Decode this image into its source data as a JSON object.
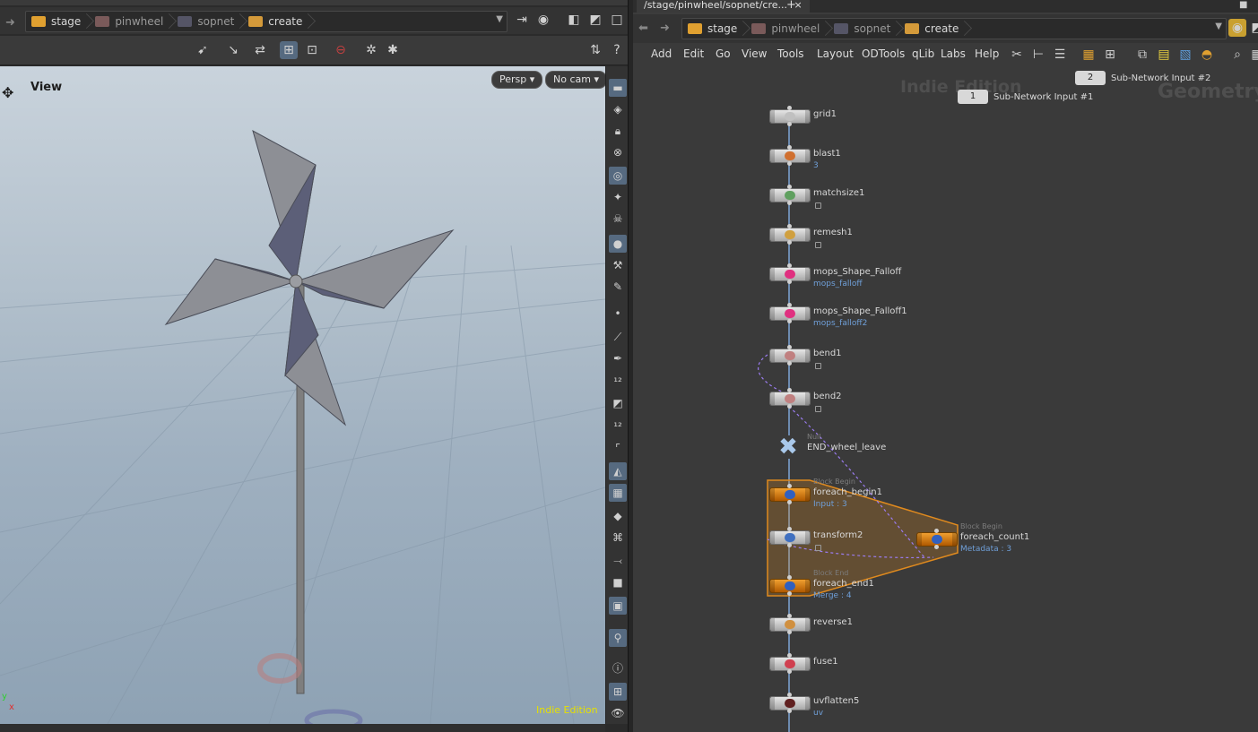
{
  "left_pane": {
    "path": [
      {
        "label": "stage"
      },
      {
        "label": "pinwheel"
      },
      {
        "label": "sopnet"
      },
      {
        "label": "create"
      }
    ],
    "viewport": {
      "title": "View",
      "persp_label": "Persp",
      "cam_label": "No cam",
      "indie_label": "Indie Edition",
      "axis_y": "y",
      "axis_x": "x"
    }
  },
  "right_pane": {
    "tab_label": "/stage/pinwheel/sopnet/cre...",
    "tab_close": "×",
    "tab_add": "+",
    "path": [
      {
        "label": "stage"
      },
      {
        "label": "pinwheel"
      },
      {
        "label": "sopnet"
      },
      {
        "label": "create"
      }
    ],
    "menu": [
      "Add",
      "Edit",
      "Go",
      "View",
      "Tools",
      "Layout",
      "ODTools",
      "qLib",
      "Labs",
      "Help"
    ],
    "watermark_indie": "Indie Edition",
    "watermark_geometry": "Geometry",
    "subnet_inputs": [
      {
        "number": "1",
        "label": "Sub-Network Input #1"
      },
      {
        "number": "2",
        "label": "Sub-Network Input #2"
      }
    ],
    "nodes": [
      {
        "name": "grid1",
        "sub": "",
        "cat": ""
      },
      {
        "name": "blast1",
        "sub": "3",
        "cat": ""
      },
      {
        "name": "matchsize1",
        "sub": "",
        "cat": ""
      },
      {
        "name": "remesh1",
        "sub": "",
        "cat": ""
      },
      {
        "name": "mops_Shape_Falloff",
        "sub": "mops_falloff",
        "cat": ""
      },
      {
        "name": "mops_Shape_Falloff1",
        "sub": "mops_falloff2",
        "cat": ""
      },
      {
        "name": "bend1",
        "sub": "",
        "cat": ""
      },
      {
        "name": "bend2",
        "sub": "",
        "cat": ""
      },
      {
        "name": "END_wheel_leave",
        "sub": "",
        "cat": "Null"
      },
      {
        "name": "foreach_begin1",
        "sub": "Input : 3",
        "cat": "Block Begin"
      },
      {
        "name": "transform2",
        "sub": "",
        "cat": ""
      },
      {
        "name": "foreach_count1",
        "sub": "Metadata : 3",
        "cat": "Block Begin"
      },
      {
        "name": "foreach_end1",
        "sub": "Merge : 4",
        "cat": "Block End"
      },
      {
        "name": "reverse1",
        "sub": "",
        "cat": ""
      },
      {
        "name": "fuse1",
        "sub": "",
        "cat": ""
      },
      {
        "name": "uvflatten5",
        "sub": "uv",
        "cat": ""
      }
    ]
  },
  "colors": {
    "accent_orange": "#e08a1e",
    "link_blue": "#6f9fd8",
    "wire_purple": "#9b7cf0",
    "indie_yellow": "#e6e000"
  }
}
